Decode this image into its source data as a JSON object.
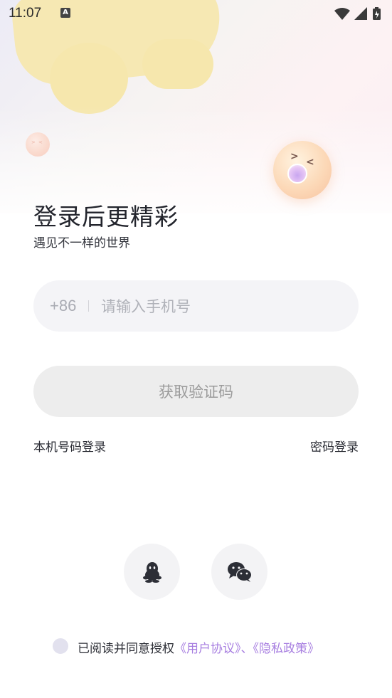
{
  "status_bar": {
    "time": "11:07",
    "notification_icon": "A"
  },
  "header": {
    "title": "登录后更精彩",
    "subtitle": "遇见不一样的世界"
  },
  "phone_form": {
    "country_code": "+86",
    "placeholder": "请输入手机号",
    "value": ""
  },
  "actions": {
    "get_code_label": "获取验证码",
    "local_number_login": "本机号码登录",
    "password_login": "密码登录"
  },
  "social": {
    "icons": [
      "qq-icon",
      "wechat-icon"
    ]
  },
  "agreement": {
    "prefix": "已阅读并同意授权",
    "user_agreement": "《用户协议》",
    "separator": "、",
    "privacy_policy": "《隐私政策》",
    "checked": false
  },
  "colors": {
    "accent_link": "#a77ee0",
    "title": "#22242c",
    "input_bg": "#f4f4f7",
    "button_disabled_bg": "#ededed"
  }
}
